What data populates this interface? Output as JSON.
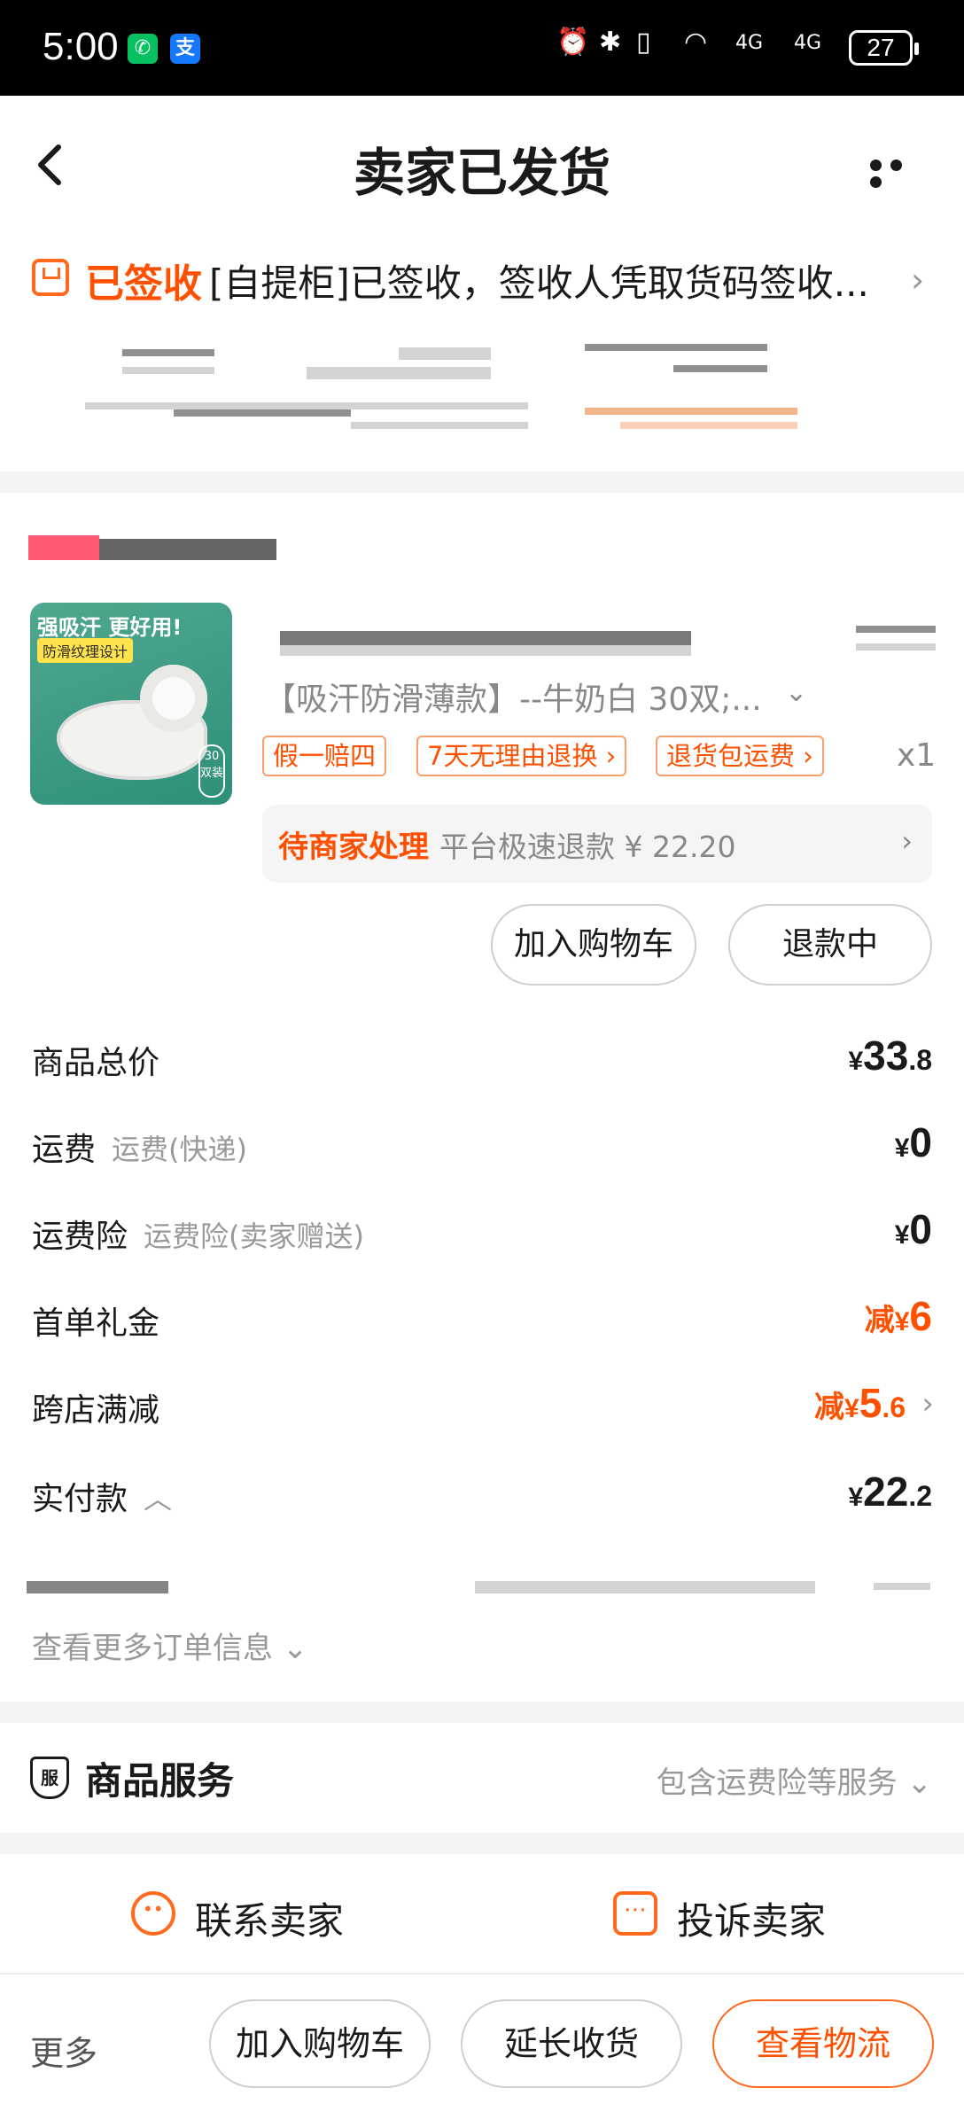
{
  "status_bar": {
    "time": "5:00",
    "wechat_glyph": "✆",
    "alipay_glyph": "支",
    "alarm_icon": "⏰",
    "bluetooth_icon": "✱",
    "vibrate_icon": "▯",
    "wifi_icon": "◠",
    "signal_1": "4G",
    "signal_2": "4G",
    "battery": "27"
  },
  "header": {
    "back_glyph": "‹",
    "title": "卖家已发货"
  },
  "logistics": {
    "status": "已签收",
    "detail": "[自提柜]已签收，签收人凭取货码签收...",
    "chevron": "›"
  },
  "product": {
    "image_text_main": "强吸汗 更好用!",
    "image_text_tag": "防滑纹理设计",
    "image_badge": "30双装",
    "sku": "【吸汗防滑薄款】--牛奶白 30双;...",
    "sku_arrow": "⌄",
    "tags": [
      "假一赔四",
      "7天无理由退换 ›",
      "退货包运费 ›"
    ],
    "quantity": "x1",
    "refund_status": "待商家处理",
    "refund_desc": "平台极速退款 ¥ 22.20",
    "refund_chevron": "›",
    "add_to_cart": "加入购物车",
    "refund_button": "退款中"
  },
  "price": {
    "rows": [
      {
        "label": "商品总价",
        "sub": "",
        "prefix": "",
        "currency": "¥",
        "integer": "33",
        "decimal": ".8",
        "orange": false
      },
      {
        "label": "运费",
        "sub": "运费(快递)",
        "prefix": "",
        "currency": "¥",
        "integer": "0",
        "decimal": "",
        "orange": false
      },
      {
        "label": "运费险",
        "sub": "运费险(卖家赠送)",
        "prefix": "",
        "currency": "¥",
        "integer": "0",
        "decimal": "",
        "orange": false
      },
      {
        "label": "首单礼金",
        "sub": "",
        "prefix": "减",
        "currency": "¥",
        "integer": "6",
        "decimal": "",
        "orange": true
      },
      {
        "label": "跨店满减",
        "sub": "",
        "prefix": "减",
        "currency": "¥",
        "integer": "5",
        "decimal": ".6",
        "orange": true
      },
      {
        "label": "实付款",
        "sub": "",
        "prefix": "",
        "currency": "¥",
        "integer": "22",
        "decimal": ".2",
        "orange": false
      }
    ],
    "paid_toggle": "︿",
    "more_info": "查看更多订单信息",
    "more_info_arrow": "⌄"
  },
  "service": {
    "icon_text": "服",
    "title": "商品服务",
    "desc": "包含运费险等服务",
    "arrow": "⌄"
  },
  "contact": {
    "seller_icon_glyph": "••",
    "contact_seller": "联系卖家",
    "complain_icon_glyph": "⋯",
    "complain_seller": "投诉卖家"
  },
  "bottom_bar": {
    "more": "更多",
    "add_to_cart": "加入购物车",
    "extend_receipt": "延长收货",
    "view_logistics": "查看物流"
  },
  "colors": {
    "accent": "#ff5000",
    "accent_border": "#f6a06e",
    "muted": "#999999"
  }
}
